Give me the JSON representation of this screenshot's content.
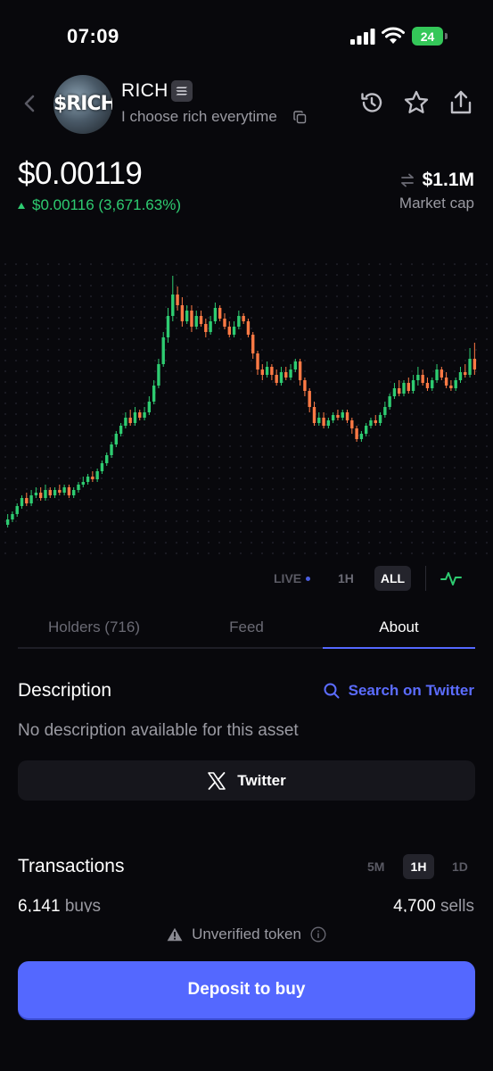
{
  "status_bar": {
    "time": "07:09",
    "battery": "24"
  },
  "header": {
    "avatar_text": "$RICH",
    "token_name": "RICH",
    "tagline": "I choose rich everytime"
  },
  "price": {
    "value": "$0.00119",
    "change": "$0.00116 (3,671.63%)",
    "market_cap": "$1.1M",
    "market_cap_label": "Market cap"
  },
  "chart_data": {
    "type": "candlestick",
    "ylim": [
      0,
      100
    ],
    "up_color": "#2ecc71",
    "down_color": "#ff7a45",
    "candles": [
      [
        4,
        6,
        3,
        8
      ],
      [
        6,
        8,
        5,
        9
      ],
      [
        8,
        11,
        7,
        12
      ],
      [
        11,
        14,
        10,
        15
      ],
      [
        14,
        12,
        11,
        16
      ],
      [
        12,
        15,
        11,
        17
      ],
      [
        15,
        16,
        14,
        18
      ],
      [
        16,
        14,
        13,
        18
      ],
      [
        14,
        17,
        13,
        19
      ],
      [
        17,
        15,
        14,
        18
      ],
      [
        15,
        17,
        14,
        18
      ],
      [
        17,
        16,
        15,
        19
      ],
      [
        16,
        18,
        15,
        19
      ],
      [
        18,
        15,
        14,
        19
      ],
      [
        15,
        17,
        14,
        18
      ],
      [
        17,
        19,
        16,
        20
      ],
      [
        19,
        20,
        18,
        22
      ],
      [
        20,
        22,
        19,
        23
      ],
      [
        22,
        21,
        20,
        24
      ],
      [
        21,
        24,
        20,
        25
      ],
      [
        24,
        27,
        23,
        28
      ],
      [
        27,
        30,
        26,
        31
      ],
      [
        30,
        34,
        29,
        35
      ],
      [
        34,
        38,
        33,
        39
      ],
      [
        38,
        41,
        37,
        42
      ],
      [
        41,
        44,
        40,
        46
      ],
      [
        44,
        42,
        41,
        47
      ],
      [
        42,
        46,
        41,
        48
      ],
      [
        46,
        44,
        43,
        47
      ],
      [
        44,
        46,
        43,
        48
      ],
      [
        46,
        50,
        45,
        52
      ],
      [
        50,
        56,
        49,
        58
      ],
      [
        56,
        64,
        55,
        66
      ],
      [
        64,
        74,
        63,
        76
      ],
      [
        74,
        82,
        72,
        85
      ],
      [
        82,
        90,
        80,
        97
      ],
      [
        90,
        86,
        84,
        93
      ],
      [
        86,
        80,
        78,
        89
      ],
      [
        80,
        84,
        79,
        86
      ],
      [
        84,
        78,
        76,
        86
      ],
      [
        78,
        82,
        77,
        84
      ],
      [
        82,
        79,
        78,
        84
      ],
      [
        79,
        76,
        74,
        81
      ],
      [
        76,
        80,
        75,
        82
      ],
      [
        80,
        85,
        79,
        87
      ],
      [
        85,
        81,
        80,
        86
      ],
      [
        81,
        78,
        77,
        83
      ],
      [
        78,
        75,
        74,
        80
      ],
      [
        75,
        78,
        74,
        80
      ],
      [
        78,
        82,
        77,
        84
      ],
      [
        82,
        80,
        79,
        83
      ],
      [
        80,
        75,
        74,
        81
      ],
      [
        75,
        68,
        66,
        76
      ],
      [
        68,
        62,
        60,
        69
      ],
      [
        62,
        60,
        58,
        64
      ],
      [
        60,
        63,
        59,
        65
      ],
      [
        63,
        60,
        58,
        64
      ],
      [
        60,
        57,
        56,
        62
      ],
      [
        57,
        61,
        56,
        63
      ],
      [
        61,
        59,
        58,
        63
      ],
      [
        59,
        62,
        58,
        64
      ],
      [
        62,
        65,
        61,
        66
      ],
      [
        65,
        58,
        56,
        66
      ],
      [
        58,
        54,
        52,
        59
      ],
      [
        54,
        48,
        46,
        55
      ],
      [
        48,
        42,
        41,
        50
      ],
      [
        42,
        44,
        41,
        46
      ],
      [
        44,
        41,
        40,
        46
      ],
      [
        41,
        43,
        40,
        44
      ],
      [
        43,
        45,
        42,
        46
      ],
      [
        45,
        44,
        43,
        47
      ],
      [
        44,
        46,
        43,
        47
      ],
      [
        46,
        43,
        42,
        47
      ],
      [
        43,
        40,
        38,
        44
      ],
      [
        40,
        36,
        35,
        41
      ],
      [
        36,
        38,
        35,
        39
      ],
      [
        38,
        41,
        37,
        42
      ],
      [
        41,
        43,
        40,
        44
      ],
      [
        43,
        42,
        41,
        45
      ],
      [
        42,
        45,
        41,
        46
      ],
      [
        45,
        48,
        44,
        50
      ],
      [
        48,
        52,
        47,
        53
      ],
      [
        52,
        55,
        51,
        57
      ],
      [
        55,
        53,
        52,
        58
      ],
      [
        53,
        57,
        52,
        58
      ],
      [
        57,
        54,
        53,
        59
      ],
      [
        54,
        58,
        53,
        60
      ],
      [
        58,
        60,
        56,
        63
      ],
      [
        60,
        57,
        56,
        62
      ],
      [
        57,
        55,
        54,
        59
      ],
      [
        55,
        58,
        54,
        59
      ],
      [
        58,
        62,
        57,
        64
      ],
      [
        62,
        59,
        58,
        63
      ],
      [
        59,
        56,
        55,
        61
      ],
      [
        56,
        55,
        54,
        58
      ],
      [
        55,
        58,
        54,
        59
      ],
      [
        58,
        61,
        57,
        63
      ],
      [
        61,
        60,
        59,
        64
      ],
      [
        60,
        66,
        59,
        70
      ],
      [
        66,
        62,
        60,
        72
      ]
    ]
  },
  "ranges": {
    "live": "LIVE",
    "h1": "1H",
    "all": "ALL"
  },
  "tabs": {
    "holders": "Holders (716)",
    "feed": "Feed",
    "about": "About"
  },
  "description": {
    "title": "Description",
    "search_label": "Search on Twitter",
    "text": "No description available for this asset",
    "twitter_label": "Twitter"
  },
  "transactions": {
    "title": "Transactions",
    "filters": {
      "m5": "5M",
      "h1": "1H",
      "d1": "1D"
    },
    "buys_count": "6,141",
    "buys_label": "buys",
    "sells_count": "4,700",
    "sells_label": "sells"
  },
  "footer": {
    "unverified": "Unverified token",
    "deposit_label": "Deposit to buy"
  },
  "colors": {
    "accent": "#5468ff",
    "positive": "#2ecc71",
    "negative": "#ff7a45",
    "background": "#08080c"
  }
}
